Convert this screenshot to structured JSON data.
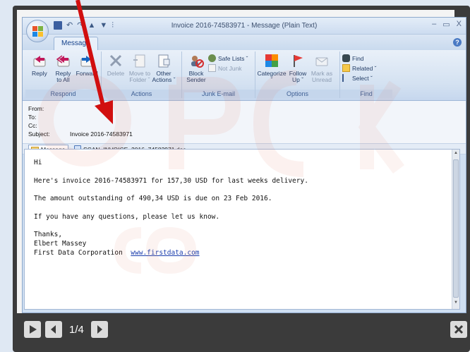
{
  "window": {
    "title": "Invoice 2016-74583971  -  Message (Plain Text)",
    "qat_separator": "∧",
    "controls": [
      "–",
      "▭",
      "X"
    ]
  },
  "ribbon": {
    "tab": "Message",
    "groups": {
      "respond": {
        "label": "Respond",
        "reply": "Reply",
        "reply_all_1": "Reply",
        "reply_all_2": "to All",
        "forward": "Forward"
      },
      "actions": {
        "label": "Actions",
        "delete": "Delete",
        "move_1": "Move to",
        "move_2": "Folder ˇ",
        "other_1": "Other",
        "other_2": "Actions ˇ"
      },
      "junk": {
        "label": "Junk E-mail",
        "block_1": "Block",
        "block_2": "Sender",
        "safe_lists": "Safe Lists ˇ",
        "not_junk": "Not Junk"
      },
      "options": {
        "label": "Options",
        "categorize": "Categorize",
        "follow_1": "Follow",
        "follow_2": "Up ˇ",
        "mark_1": "Mark as",
        "mark_2": "Unread"
      },
      "find": {
        "label": "Find",
        "find": "Find",
        "related": "Related ˇ",
        "select": "Select ˇ"
      }
    }
  },
  "headers": {
    "from_label": "From:",
    "to_label": "To:",
    "cc_label": "Cc:",
    "subject_label": "Subject:",
    "subject_value": "Invoice 2016-74583971"
  },
  "attachments": {
    "message_tab": "Message",
    "file": "SCAN_INVOICE_2016_74583971.doc"
  },
  "body": {
    "greeting": "Hi",
    "line1": "Here's invoice 2016-74583971 for 157,30 USD for last weeks delivery.",
    "line2": "The amount outstanding of 490,34 USD is due on 23 Feb 2016.",
    "line3": "If you have any questions, please let us know.",
    "sig1": "Thanks,",
    "sig2": "Elbert Massey",
    "sig3": "First Data Corporation",
    "link": "www.firstdata.com"
  },
  "lightbox": {
    "counter": "1/4"
  },
  "colors": {
    "arrow": "#d10f0f",
    "link": "#1c3fae",
    "ribbon_text": "#15428b"
  }
}
